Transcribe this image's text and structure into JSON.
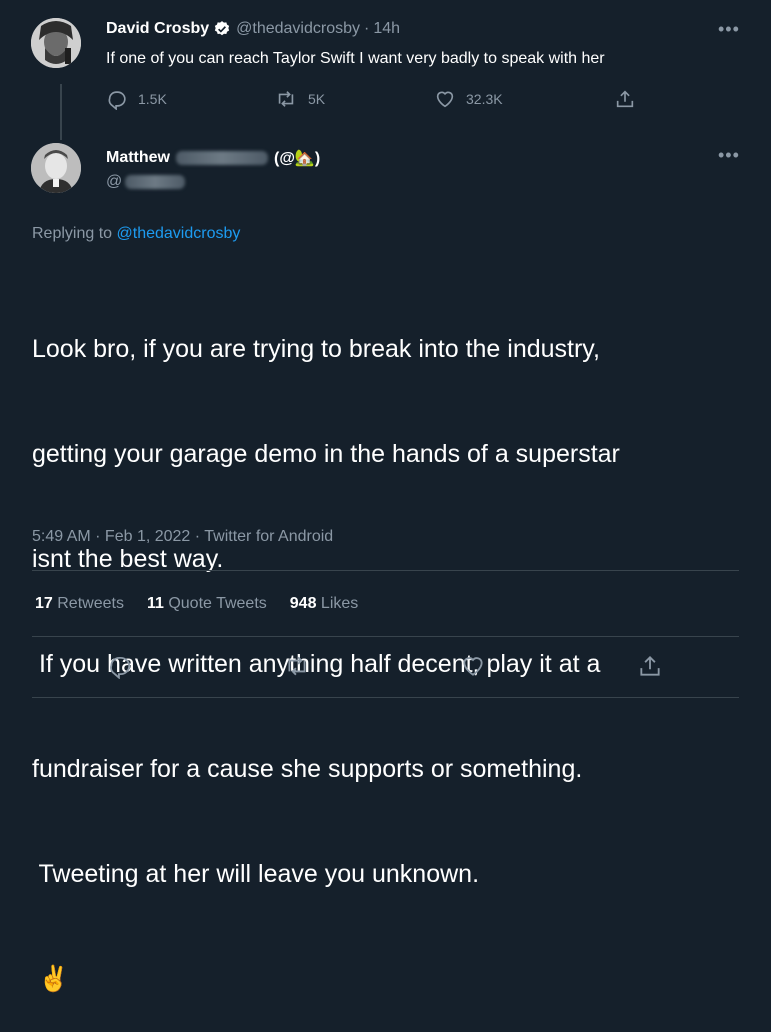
{
  "tweet1": {
    "name": "David Crosby",
    "handle": "@thedavidcrosby",
    "sep": "·",
    "time": "14h",
    "text": "If one of you can reach Taylor Swift I want very badly to speak with her",
    "replies": "1.5K",
    "retweets": "5K",
    "likes": "32.3K"
  },
  "tweet2": {
    "name_first": "Matthew",
    "name_suffix": "(@🏡)",
    "handle_prefix": "@",
    "replying_prefix": "Replying to",
    "replying_handle": "@thedavidcrosby",
    "body_lines": [
      "Look bro, if you are trying to break into the industry,",
      "getting your garage demo in the hands of a superstar",
      "isnt the best way.",
      " If you have written anything half decent, play it at a",
      "fundraiser for a cause she supports or something.",
      " Tweeting at her will leave you unknown.",
      "✌️"
    ],
    "meta": "5:49 AM · Feb 1, 2022 · Twitter for Android",
    "retweets_count": "17",
    "retweets_label": "Retweets",
    "quotes_count": "11",
    "quotes_label": "Quote Tweets",
    "likes_count": "948",
    "likes_label": "Likes"
  },
  "colors": {
    "background": "#15202b",
    "muted": "#8b98a5",
    "link": "#1d9bf0",
    "divider": "#38444d"
  },
  "icons": [
    "verified-badge-icon",
    "more-icon",
    "reply-icon",
    "retweet-icon",
    "like-icon",
    "share-icon"
  ]
}
